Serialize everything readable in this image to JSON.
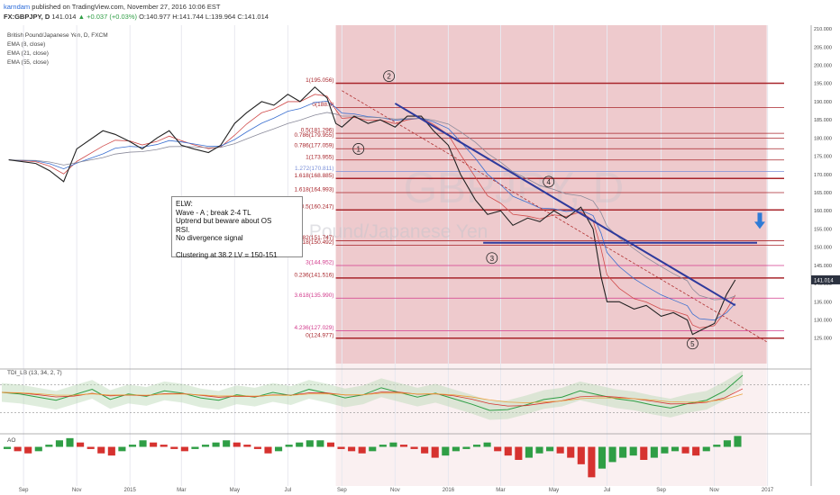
{
  "header": {
    "user": "karndam",
    "published": "published on TradingView.com, November 27, 2016 10:06 EST",
    "ticker": "FX:GBPJPY, D",
    "quote": "141.014",
    "change": "+0.037 (+0.03%)",
    "ohlc": "O:140.977 H:141.744 L:139.964 C:141.014"
  },
  "indicators": {
    "title": "British Pound/Japanese Yen, D, FXCM",
    "ema1": "EMA (8, close)",
    "ema2": "EMA (21, close)",
    "ema3": "EMA (55, close)",
    "tdi": "TDI_LB (13, 34, 2, 7)",
    "ao": "AO"
  },
  "watermark": {
    "symbol": "GBPJPY, D",
    "name": "British Pound/Japanese Yen"
  },
  "note": {
    "lines": [
      "ELW:",
      "Wave - A ; break 2-4 TL",
      "Uptrend but beware about OS",
      "RSI.",
      "No divergence signal",
      "",
      "Clustering at 38.2 LV = 150-151"
    ]
  },
  "colors": {
    "zone": "#d9848a",
    "fib_red": "#a8252b",
    "fib_pink": "#d23a8c",
    "fib_blue": "#7a8fd8",
    "trend_blue": "#2e3a9c",
    "arrow_blue": "#2f7bd6",
    "ao_up": "#2f9e45",
    "ao_down": "#d6322f"
  },
  "chart_data": [
    {
      "type": "line",
      "title": "British Pound/Japanese Yen, D, FXCM",
      "ylim": [
        118,
        211
      ],
      "y_ticks": [
        "125.000",
        "130.000",
        "135.000",
        "140.000",
        "145.000",
        "150.000",
        "155.000",
        "160.000",
        "165.000",
        "170.000",
        "175.000",
        "180.000",
        "185.000",
        "190.000",
        "195.000",
        "200.000",
        "205.000",
        "210.000"
      ],
      "x_ticks": [
        "Sep",
        "Nov",
        "2015",
        "Mar",
        "May",
        "Jul",
        "Sep",
        "Nov",
        "2016",
        "Mar",
        "May",
        "Jul",
        "Sep",
        "Nov",
        "2017"
      ],
      "last_price": "141.014",
      "series": [
        {
          "name": "",
          "x": [
            "2014-08-15",
            "2014-09-15",
            "2014-10-01",
            "2014-10-17",
            "2014-11-01",
            "2014-12-01",
            "2014-12-15",
            "2015-01-01",
            "2015-01-15",
            "2015-02-01",
            "2015-02-15",
            "2015-03-01",
            "2015-03-15",
            "2015-04-01",
            "2015-04-15",
            "2015-05-01",
            "2015-05-15",
            "2015-06-01",
            "2015-06-15",
            "2015-07-01",
            "2015-07-15",
            "2015-08-01",
            "2015-08-15",
            "2015-08-25",
            "2015-09-01",
            "2015-09-15",
            "2015-10-01",
            "2015-10-15",
            "2015-11-01",
            "2015-11-15",
            "2015-12-01",
            "2015-12-15",
            "2016-01-01",
            "2016-01-15",
            "2016-02-01",
            "2016-02-15",
            "2016-03-01",
            "2016-03-15",
            "2016-04-01",
            "2016-04-15",
            "2016-05-01",
            "2016-05-15",
            "2016-06-01",
            "2016-06-15",
            "2016-06-24",
            "2016-07-01",
            "2016-07-15",
            "2016-08-01",
            "2016-08-15",
            "2016-09-01",
            "2016-09-15",
            "2016-10-01",
            "2016-10-07",
            "2016-10-15",
            "2016-11-01",
            "2016-11-15",
            "2016-11-25"
          ],
          "values": [
            174,
            173,
            171,
            168,
            177,
            182,
            181,
            179,
            177,
            180,
            182,
            178,
            177,
            176,
            178,
            184,
            187,
            190,
            189,
            192,
            190,
            194,
            191,
            184,
            183,
            186,
            184,
            185,
            183,
            186,
            186,
            182,
            178,
            170,
            163,
            159,
            160,
            156,
            158,
            157,
            160,
            158,
            161,
            155,
            142,
            135,
            135,
            133,
            134,
            131,
            132,
            130,
            126,
            127,
            129,
            137,
            141
          ]
        }
      ],
      "fib_levels": [
        {
          "label": "1(195.056)",
          "value": 195.056
        },
        {
          "label": "0(188.4)",
          "value": 188.4
        },
        {
          "label": "0.5(181.296)",
          "value": 181.296
        },
        {
          "label": "0.786(179.955)",
          "value": 179.955
        },
        {
          "label": "0.786(177.059)",
          "value": 177.059
        },
        {
          "label": "1(173.955)",
          "value": 173.955
        },
        {
          "label": "1.272(170.811)",
          "value": 170.811
        },
        {
          "label": "1.618(168.885)",
          "value": 168.885
        },
        {
          "label": "1.618(164.993)",
          "value": 164.993
        },
        {
          "label": "0.5(160.247)",
          "value": 160.247
        },
        {
          "label": "0.382(151.747)",
          "value": 151.747
        },
        {
          "label": "2.618(150.492)",
          "value": 150.492
        },
        {
          "label": "3(144.952)",
          "value": 144.952
        },
        {
          "label": "0.236(141.516)",
          "value": 141.516
        },
        {
          "label": "3.618(135.990)",
          "value": 135.99
        },
        {
          "label": "4.236(127.029)",
          "value": 127.029
        },
        {
          "label": "0(124.977)",
          "value": 124.977
        }
      ],
      "wave_labels": [
        {
          "label": "1",
          "x": "2015-09-20",
          "value": 177
        },
        {
          "label": "2",
          "x": "2015-10-25",
          "value": 197
        },
        {
          "label": "3",
          "x": "2016-02-20",
          "value": 147
        },
        {
          "label": "4",
          "x": "2016-04-25",
          "value": 168
        },
        {
          "label": "5",
          "x": "2016-10-07",
          "value": 123.5
        }
      ]
    },
    {
      "type": "line",
      "title": "TDI_LB (13, 34, 2, 7)",
      "ylim": [
        12,
        88
      ],
      "y_ticks": [
        "25.0000",
        "50.0000",
        "75.0000"
      ],
      "series": [
        {
          "name": "",
          "x": [
            0,
            20,
            40,
            60,
            80,
            100,
            120,
            140,
            160,
            180,
            200,
            220,
            240,
            260,
            280,
            300,
            320,
            340,
            360,
            380,
            400,
            420,
            440,
            460,
            480,
            500,
            520,
            540,
            560,
            580,
            600,
            620,
            640,
            660,
            680,
            700,
            720,
            740,
            760,
            780,
            800,
            820
          ],
          "values": [
            58,
            56,
            52,
            48,
            55,
            62,
            49,
            56,
            53,
            60,
            57,
            51,
            48,
            55,
            52,
            58,
            54,
            62,
            57,
            51,
            55,
            64,
            58,
            52,
            57,
            50,
            43,
            35,
            36,
            42,
            49,
            52,
            60,
            55,
            50,
            47,
            42,
            38,
            44,
            48,
            60,
            80
          ]
        }
      ]
    },
    {
      "type": "bar",
      "title": "AO",
      "ylim": [
        -18,
        6
      ],
      "y_ticks": [
        "0.0000",
        "-10.0000"
      ],
      "series": [
        {
          "name": "",
          "values": [
            -1,
            -2,
            -3,
            -2,
            1,
            3,
            4,
            2,
            -1,
            -3,
            -4,
            -2,
            1,
            3,
            2,
            1,
            -1,
            -2,
            -1,
            1,
            2,
            3,
            2,
            1,
            -1,
            -3,
            -2,
            1,
            2,
            3,
            3,
            2,
            -1,
            -2,
            -3,
            -2,
            1,
            2,
            1,
            -1,
            -3,
            -5,
            -4,
            -2,
            -1,
            1,
            2,
            -2,
            -4,
            -6,
            -5,
            -3,
            -2,
            -3,
            -5,
            -8,
            -14,
            -10,
            -7,
            -5,
            -4,
            -6,
            -5,
            -3,
            -2,
            -3,
            -4,
            -2,
            1,
            3,
            5
          ]
        }
      ]
    }
  ]
}
